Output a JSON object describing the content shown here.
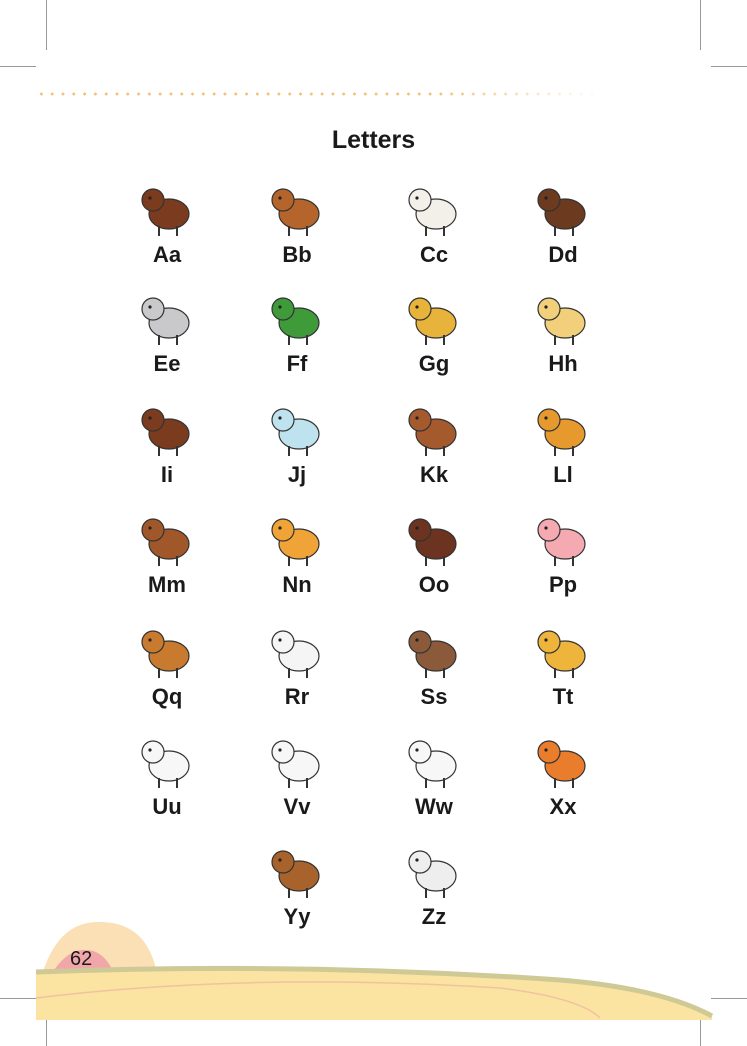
{
  "page": {
    "title": "Letters",
    "page_number": "62"
  },
  "letters": [
    {
      "label": "Aa",
      "icon": "ant-icon",
      "color": "#7a3b1e"
    },
    {
      "label": "Bb",
      "icon": "bear-icon",
      "color": "#b5652b"
    },
    {
      "label": "Cc",
      "icon": "cow-icon",
      "color": "#f3f0ea"
    },
    {
      "label": "Dd",
      "icon": "dog-icon",
      "color": "#6b3a1f"
    },
    {
      "label": "Ee",
      "icon": "elephant-icon",
      "color": "#c9c9cc"
    },
    {
      "label": "Ff",
      "icon": "frog-icon",
      "color": "#3f9a3a"
    },
    {
      "label": "Gg",
      "icon": "giraffe-icon",
      "color": "#e7b33a"
    },
    {
      "label": "Hh",
      "icon": "hen-icon",
      "color": "#f1cf7b"
    },
    {
      "label": "Ii",
      "icon": "insect-beetle-icon",
      "color": "#7a3b1e"
    },
    {
      "label": "Jj",
      "icon": "jellyfish-icon",
      "color": "#bfe3ee"
    },
    {
      "label": "Kk",
      "icon": "kangaroo-icon",
      "color": "#a55a2e"
    },
    {
      "label": "Ll",
      "icon": "lion-icon",
      "color": "#e69a2e"
    },
    {
      "label": "Mm",
      "icon": "monkey-icon",
      "color": "#a0582a"
    },
    {
      "label": "Nn",
      "icon": "bird-icon",
      "color": "#f0a438"
    },
    {
      "label": "Oo",
      "icon": "ox-icon",
      "color": "#6b3320"
    },
    {
      "label": "Pp",
      "icon": "pig-icon",
      "color": "#f4aab0"
    },
    {
      "label": "Qq",
      "icon": "queen-bee-icon",
      "color": "#c87a2f"
    },
    {
      "label": "Rr",
      "icon": "rabbit-icon",
      "color": "#f5f5f5"
    },
    {
      "label": "Ss",
      "icon": "snake-icon",
      "color": "#8a5a3a"
    },
    {
      "label": "Tt",
      "icon": "tiger-icon",
      "color": "#efb43c"
    },
    {
      "label": "Uu",
      "icon": "duck-icon",
      "color": "#f7f7f7"
    },
    {
      "label": "Vv",
      "icon": "dove-icon",
      "color": "#f7f7f7"
    },
    {
      "label": "Ww",
      "icon": "swan-icon",
      "color": "#f7f7f7"
    },
    {
      "label": "Xx",
      "icon": "fox-icon",
      "color": "#ea7d2c"
    },
    {
      "label": "Yy",
      "icon": "yak-icon",
      "color": "#a8622b"
    },
    {
      "label": "Zz",
      "icon": "zebra-icon",
      "color": "#eeeeee"
    }
  ],
  "colors": {
    "dots": "#f1c27a",
    "sun_outer": "#fbe0b6",
    "sun_inner": "#f1a7a9",
    "ground": "#fbe3a1",
    "ground_edge": "#cfc995"
  }
}
